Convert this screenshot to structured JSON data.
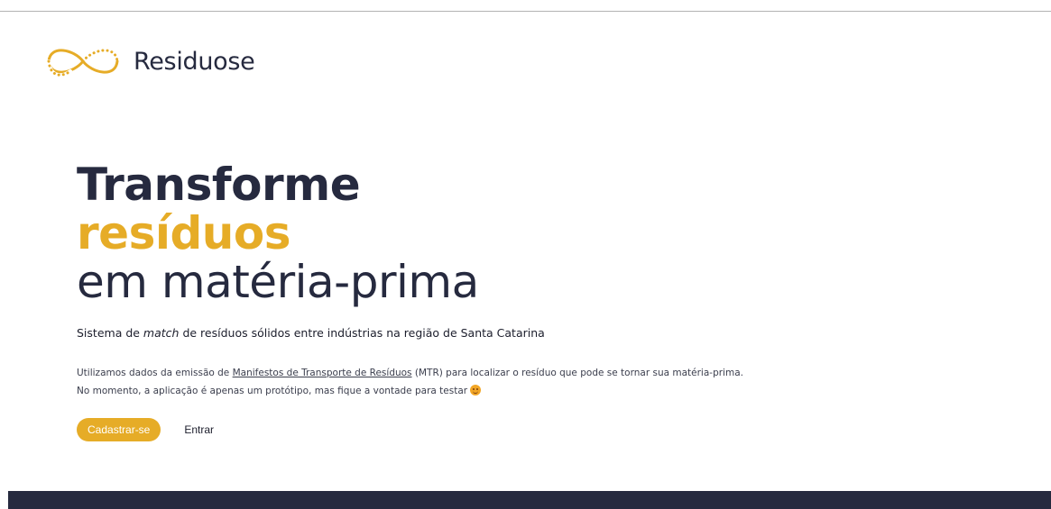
{
  "colors": {
    "accent": "#e6ac27",
    "text_dark": "#262a3f",
    "footer": "#262a3f"
  },
  "header": {
    "logo_icon": "infinity-icon",
    "brand": "Residuose"
  },
  "hero": {
    "line1": "Transforme",
    "line2": "resíduos",
    "line3": "em matéria-prima"
  },
  "subtitle": {
    "prefix": "Sistema de ",
    "emphasis": "match",
    "suffix": " de resíduos sólidos entre indústrias na região de Santa Catarina"
  },
  "description": {
    "line1_prefix": "Utilizamos dados da emissão de ",
    "line1_link": "Manifestos de Transporte de Resíduos",
    "line1_suffix": " (MTR) para localizar o resíduo que pode se tornar sua matéria-prima.",
    "line2": "No momento, a aplicação é apenas um protótipo, mas fique a vontade para testar ",
    "line2_icon": "smiling-face-icon"
  },
  "actions": {
    "signup_label": "Cadastrar-se",
    "login_label": "Entrar"
  }
}
